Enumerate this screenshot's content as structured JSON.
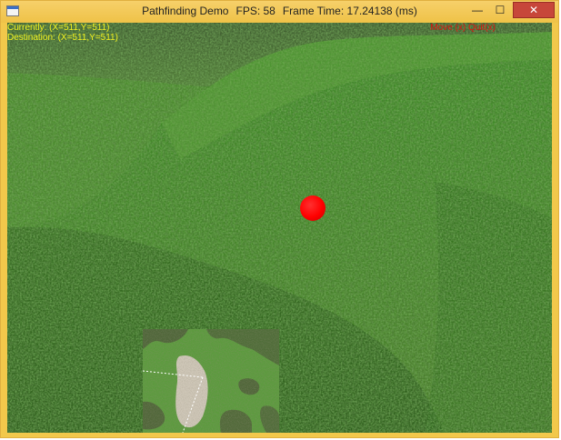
{
  "window": {
    "title": "Pathfinding Demo",
    "fps_label": "FPS: 58",
    "frame_time_label": "Frame Time: 17.24138 (ms)",
    "buttons": {
      "minimize": "—",
      "maximize": "☐",
      "close": "✕"
    }
  },
  "hud": {
    "currently": "Currently: (X=511,Y=511)",
    "destination": "Destination: (X=511,Y=511)",
    "status": "Move (x) Quit(x)"
  },
  "icons": {
    "app": "app-icon",
    "minimize": "minimize-icon",
    "maximize": "maximize-icon",
    "close": "close-icon"
  },
  "colors": {
    "hud_text": "#f0f020",
    "status_text": "#e01010",
    "player": "#ff0000",
    "titlebar": "#f2c84b"
  }
}
